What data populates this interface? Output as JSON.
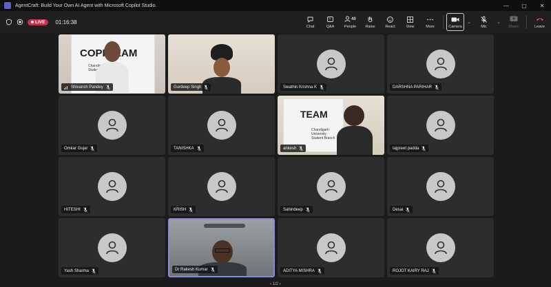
{
  "window": {
    "title": "AgentCraft: Build Your Own AI Agent with Microsoft Copilot Studio.",
    "controls": [
      "—",
      "▢",
      "✕"
    ]
  },
  "meeting": {
    "live_label": "LIVE",
    "timer": "01:16:38"
  },
  "toolbar": {
    "chat": "Chat",
    "qa": "Q&A",
    "people": "People",
    "people_count": "40",
    "raise": "Raise",
    "react": "React",
    "view": "View",
    "more": "More",
    "camera": "Camera",
    "mic": "Mic",
    "share": "Share",
    "leave": "Leave"
  },
  "participants": [
    {
      "name": "Shivansh Pandey"
    },
    {
      "name": "Gurdeep Singh"
    },
    {
      "name": "Swathin Krishna K"
    },
    {
      "name": "DARSHNA PARIHAR"
    },
    {
      "name": "Omkar Gujar"
    },
    {
      "name": "TANISHKA"
    },
    {
      "name": "ankesh"
    },
    {
      "name": "tajpreet padda"
    },
    {
      "name": "HITESHI"
    },
    {
      "name": "KRISH"
    },
    {
      "name": "Sahindeep"
    },
    {
      "name": "Desai"
    },
    {
      "name": "Yash Sharma"
    },
    {
      "name": "Dr Rakesh Kumar"
    },
    {
      "name": "ADITYA MISHRA"
    },
    {
      "name": "ROJOT KAIRY RAJ"
    }
  ],
  "posters": {
    "p1": "COPI TEAM",
    "p1_sub": "Chandigarh University Student Branch",
    "p2": "TEAM",
    "p2_sub": "Chandigarh University Student Branch"
  },
  "pager": "1/2",
  "colors": {
    "leave": "#e0475f",
    "live": "#c4314b",
    "active_border": "#8a88e0"
  }
}
